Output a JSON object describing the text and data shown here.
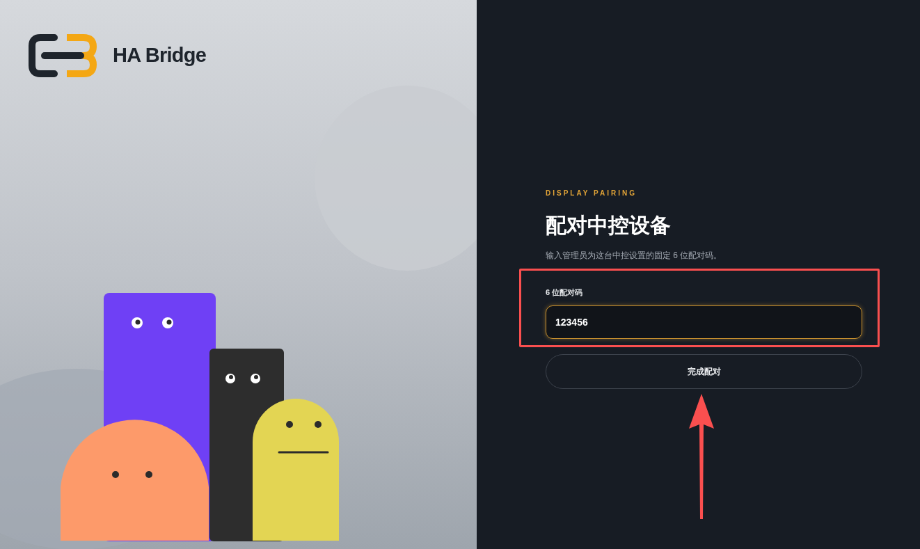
{
  "brand": {
    "name": "HA Bridge"
  },
  "form": {
    "eyebrow": "DISPLAY PAIRING",
    "title": "配对中控设备",
    "description": "输入管理员为这台中控设置的固定 6 位配对码。",
    "field": {
      "label": "6 位配对码",
      "value": "123456",
      "focused": true
    },
    "submit": "完成配对"
  }
}
